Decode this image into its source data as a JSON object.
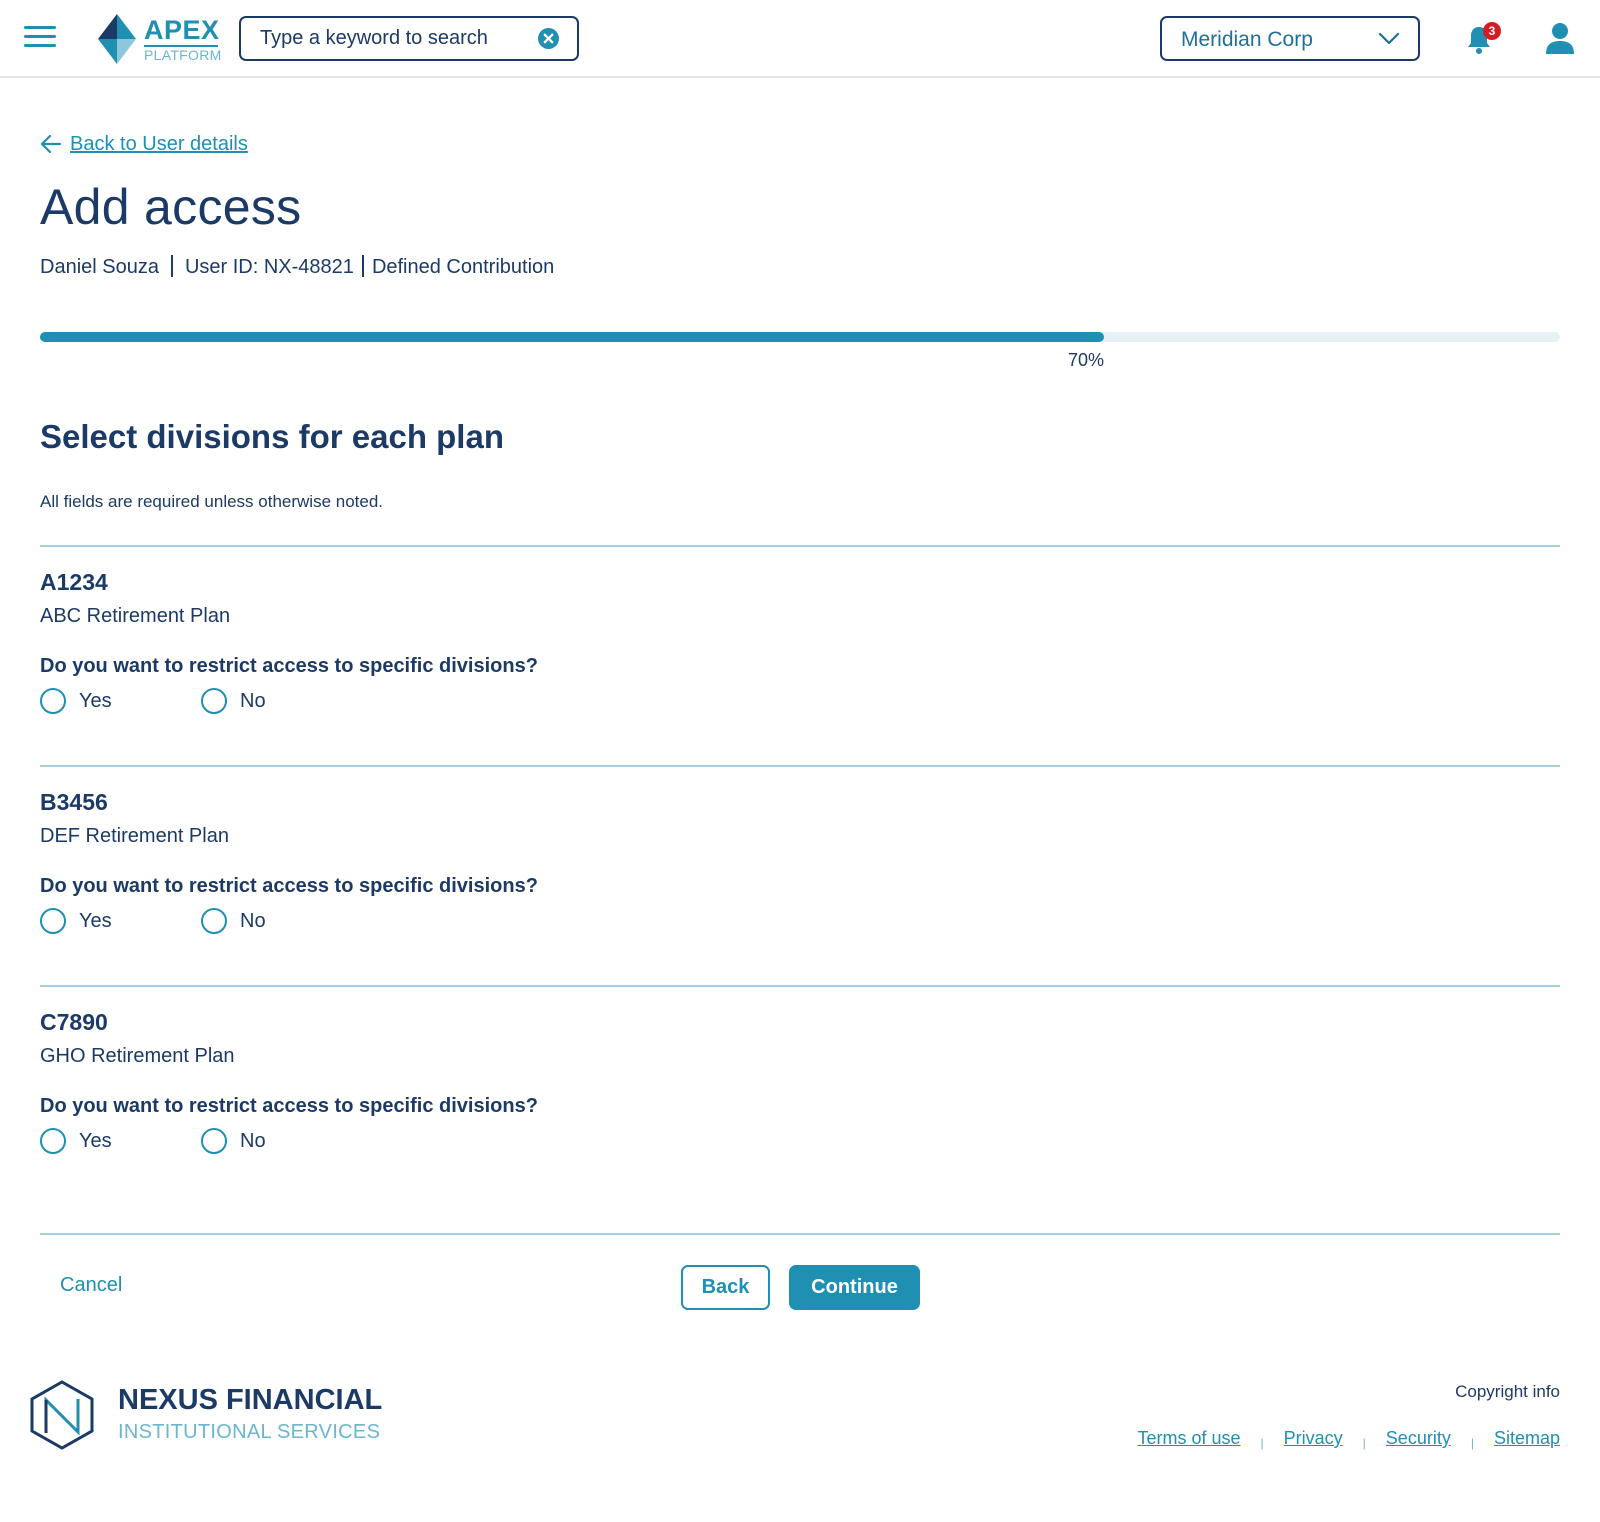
{
  "header": {
    "logo_title": "APEX",
    "logo_subtitle": "PLATFORM",
    "search_placeholder": "Type a keyword to search",
    "org_selected": "Meridian Corp",
    "notification_count": "3"
  },
  "nav": {
    "back_link": "Back to User details"
  },
  "page": {
    "title": "Add access",
    "user_name": "Daniel Souza",
    "user_id": "User ID: NX-48821",
    "plan_type": "Defined Contribution"
  },
  "progress": {
    "value": 0.7,
    "label": "70%"
  },
  "section": {
    "title": "Select divisions for each plan",
    "note": "All fields are required unless otherwise noted."
  },
  "plans": [
    {
      "id": "A1234",
      "name": "ABC Retirement Plan",
      "question": "Do you want to restrict access to specific divisions?",
      "options": [
        "Yes",
        "No"
      ]
    },
    {
      "id": "B3456",
      "name": "DEF Retirement Plan",
      "question": "Do you want to restrict access to specific divisions?",
      "options": [
        "Yes",
        "No"
      ]
    },
    {
      "id": "C7890",
      "name": "GHO Retirement Plan",
      "question": "Do you want to restrict access to specific divisions?",
      "options": [
        "Yes",
        "No"
      ]
    }
  ],
  "actions": {
    "cancel": "Cancel",
    "back": "Back",
    "continue": "Continue"
  },
  "footer": {
    "brand_name": "NEXUS FINANCIAL",
    "brand_sub": "INSTITUTIONAL SERVICES",
    "copyright": "Copyright info",
    "links": [
      "Terms of use",
      "Privacy",
      "Security",
      "Sitemap"
    ]
  },
  "colors": {
    "primary": "#1f8fb2",
    "navy": "#1c3a66",
    "divider": "#a7cfdc",
    "badge": "#d41c24"
  }
}
